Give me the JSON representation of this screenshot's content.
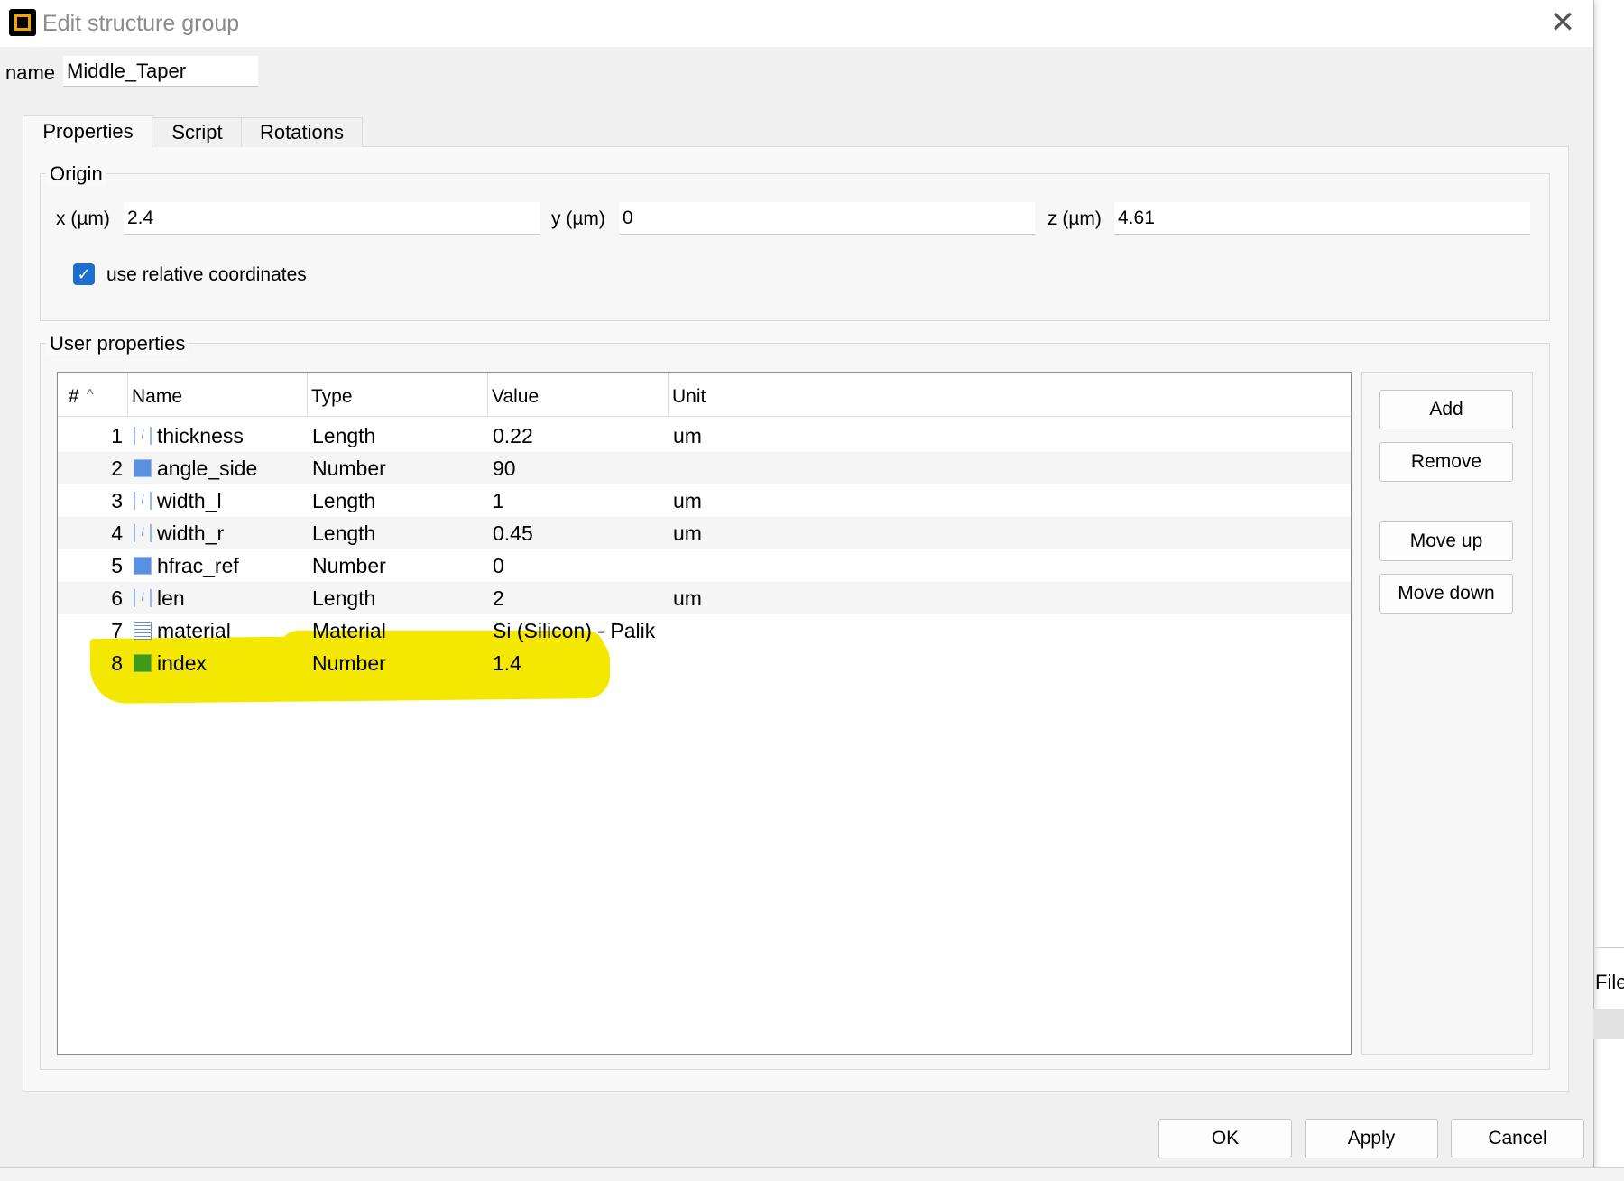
{
  "window": {
    "title": "Edit structure group",
    "close_glyph": "✕"
  },
  "name_field": {
    "label": "name",
    "value": "Middle_Taper"
  },
  "tabs": [
    {
      "label": "Properties",
      "active": true
    },
    {
      "label": "Script",
      "active": false
    },
    {
      "label": "Rotations",
      "active": false
    }
  ],
  "origin": {
    "title": "Origin",
    "x_label": "x (µm)",
    "x_value": "2.4",
    "y_label": "y (µm)",
    "y_value": "0",
    "z_label": "z (µm)",
    "z_value": "4.61",
    "relative_label": "use relative coordinates",
    "relative_checked": true
  },
  "user_properties": {
    "title": "User properties",
    "sort_glyph": "^",
    "columns": [
      "#",
      "Name",
      "Type",
      "Value",
      "Unit"
    ],
    "rows": [
      {
        "num": "1",
        "icon": "length-icon",
        "name": "thickness",
        "type": "Length",
        "value": "0.22",
        "unit": "um"
      },
      {
        "num": "2",
        "icon": "number-icon",
        "name": "angle_side",
        "type": "Number",
        "value": "90",
        "unit": ""
      },
      {
        "num": "3",
        "icon": "length-icon",
        "name": "width_l",
        "type": "Length",
        "value": "1",
        "unit": "um"
      },
      {
        "num": "4",
        "icon": "length-icon",
        "name": "width_r",
        "type": "Length",
        "value": "0.45",
        "unit": "um"
      },
      {
        "num": "5",
        "icon": "number-icon",
        "name": "hfrac_ref",
        "type": "Number",
        "value": "0",
        "unit": ""
      },
      {
        "num": "6",
        "icon": "length-icon",
        "name": "len",
        "type": "Length",
        "value": "2",
        "unit": "um"
      },
      {
        "num": "7",
        "icon": "material-icon",
        "name": "material",
        "type": "Material",
        "value": "Si (Silicon) - Palik",
        "unit": ""
      },
      {
        "num": "8",
        "icon": "number-icon",
        "name": "index",
        "type": "Number",
        "value": "1.4",
        "unit": ""
      }
    ],
    "buttons": {
      "add": "Add",
      "remove": "Remove",
      "move_up": "Move up",
      "move_down": "Move down"
    }
  },
  "footer": {
    "ok": "OK",
    "apply": "Apply",
    "cancel": "Cancel"
  },
  "background": {
    "file_text": "File"
  },
  "colors": {
    "highlight": "#f5e800",
    "checkbox": "#1a6fcf",
    "app_icon_accent": "#f5a300"
  }
}
